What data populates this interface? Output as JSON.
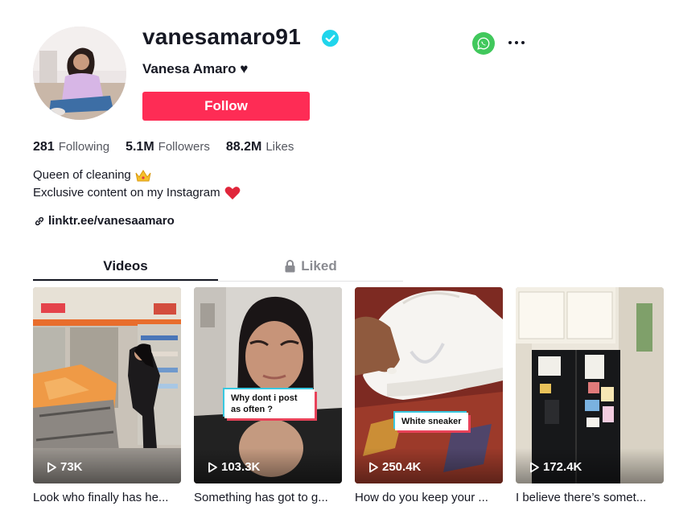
{
  "profile": {
    "username": "vanesamaro91",
    "display_name": "Vanesa Amaro ♥",
    "follow_label": "Follow",
    "verified": true
  },
  "stats": [
    {
      "value": "281",
      "label": "Following"
    },
    {
      "value": "5.1M",
      "label": "Followers"
    },
    {
      "value": "88.2M",
      "label": "Likes"
    }
  ],
  "bio": {
    "line1": "Queen of cleaning",
    "line2": "Exclusive content on my Instagram"
  },
  "link": "linktr.ee/vanesaamaro",
  "tabs": {
    "videos": "Videos",
    "liked": "Liked"
  },
  "videos": [
    {
      "views": "73K",
      "caption": "Look who finally has he...",
      "overlay": ""
    },
    {
      "views": "103.3K",
      "caption": "Something has got to g...",
      "overlay": "Why dont i post as often ?"
    },
    {
      "views": "250.4K",
      "caption": "How do you keep your ...",
      "overlay": "White sneaker"
    },
    {
      "views": "172.4K",
      "caption": "I believe there’s somet...",
      "overlay": ""
    }
  ],
  "colors": {
    "follow": "#fe2c55",
    "verified": "#20d5ec",
    "whatsapp": "#41c85c",
    "text": "#161823",
    "muted": "#8a8b91"
  },
  "icons": {
    "verified": "verified-badge-icon",
    "whatsapp": "whatsapp-icon",
    "more": "more-options-icon",
    "crown": "crown-emoji-icon",
    "heart": "red-heart-emoji-icon",
    "link": "link-icon",
    "lock": "lock-icon",
    "play": "play-icon"
  }
}
